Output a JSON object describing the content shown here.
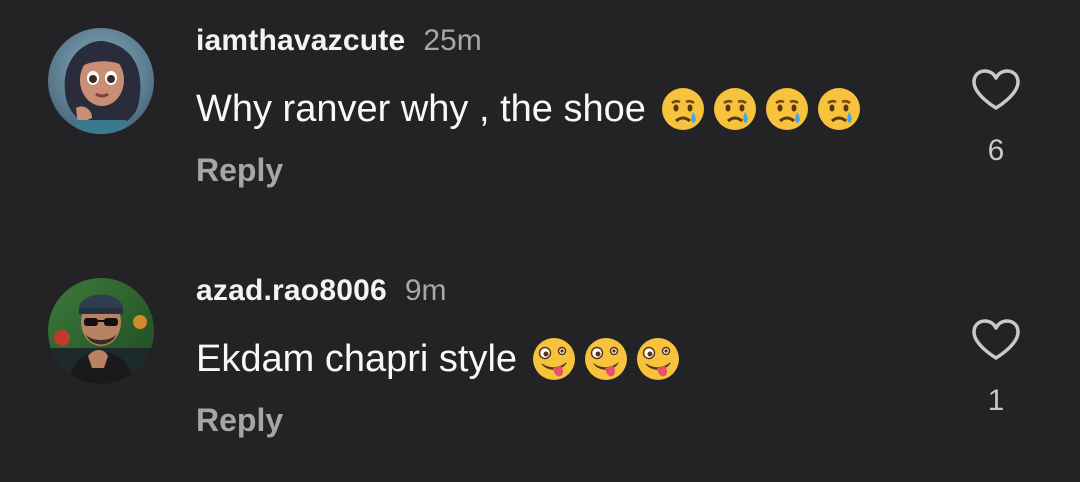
{
  "comments": [
    {
      "username": "iamthavazcute",
      "time": "25m",
      "text": "Why ranver why , the shoe",
      "emojis": [
        "crying-face",
        "crying-face",
        "crying-face",
        "crying-face"
      ],
      "reply_label": "Reply",
      "like_count": "6",
      "avatar": "cartoon-girl-avatar"
    },
    {
      "username": "azad.rao8006",
      "time": "9m",
      "text": "Ekdam chapri style",
      "emojis": [
        "zany-face",
        "zany-face",
        "zany-face"
      ],
      "reply_label": "Reply",
      "like_count": "1",
      "avatar": "man-sunglasses-avatar"
    }
  ],
  "colors": {
    "background": "#232325",
    "username": "#f3f3f3",
    "secondary": "#a6a6a8",
    "emoji_face": "#f7c23c"
  }
}
